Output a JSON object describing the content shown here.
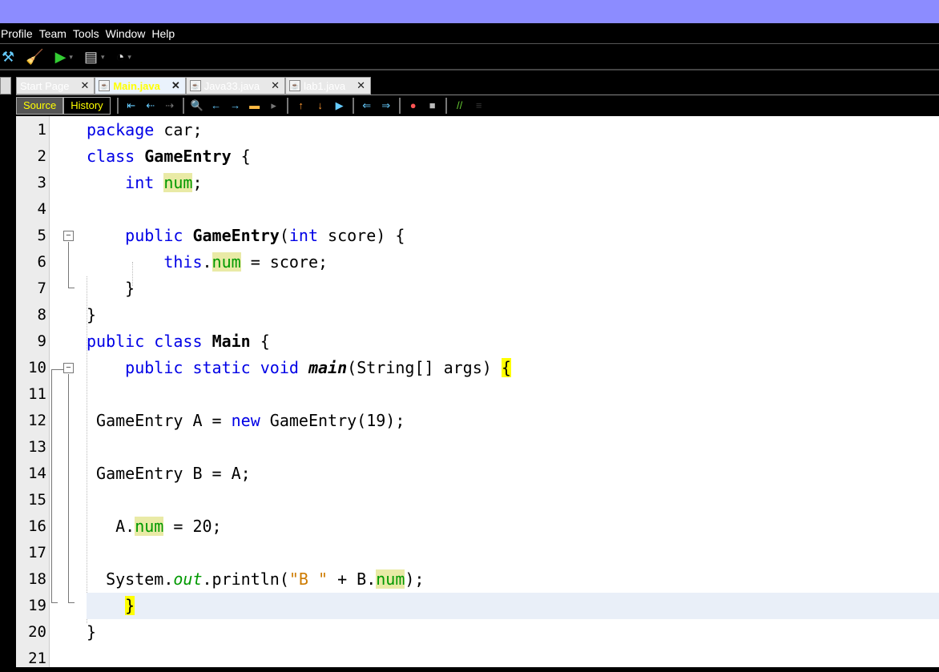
{
  "menu": [
    "Profile",
    "Team",
    "Tools",
    "Window",
    "Help"
  ],
  "tabs": [
    {
      "label": "Start Page",
      "active": false,
      "icon": ""
    },
    {
      "label": "Main.java",
      "active": true,
      "icon": "java-file-icon"
    },
    {
      "label": "Java33.java",
      "active": false,
      "icon": "java-file-error-icon"
    },
    {
      "label": "lab1.java",
      "active": false,
      "icon": "java-file-icon"
    }
  ],
  "editor_toolbar": {
    "source": "Source",
    "history": "History"
  },
  "code": [
    [
      [
        "package",
        "kw"
      ],
      [
        " car;",
        ""
      ]
    ],
    [
      [
        "class",
        "kw"
      ],
      [
        " ",
        ""
      ],
      [
        "GameEntry",
        "cls"
      ],
      [
        " {",
        ""
      ]
    ],
    [
      [
        "    ",
        ""
      ],
      [
        "int",
        "kw"
      ],
      [
        " ",
        ""
      ],
      [
        "num",
        "fld"
      ],
      [
        ";",
        ""
      ]
    ],
    [],
    [
      [
        "    ",
        ""
      ],
      [
        "public",
        "kw"
      ],
      [
        " ",
        ""
      ],
      [
        "GameEntry",
        "cls"
      ],
      [
        "(",
        ""
      ],
      [
        "int",
        "kw"
      ],
      [
        " score) {",
        ""
      ]
    ],
    [
      [
        "        ",
        ""
      ],
      [
        "this",
        "kw"
      ],
      [
        ".",
        ""
      ],
      [
        "num",
        "fld"
      ],
      [
        " = score;",
        ""
      ]
    ],
    [
      [
        "    }",
        ""
      ]
    ],
    [
      [
        "}",
        ""
      ]
    ],
    [
      [
        "public",
        "kw"
      ],
      [
        " ",
        ""
      ],
      [
        "class",
        "kw"
      ],
      [
        " ",
        ""
      ],
      [
        "Main",
        "cls"
      ],
      [
        " {",
        ""
      ]
    ],
    [
      [
        "    ",
        ""
      ],
      [
        "public",
        "kw"
      ],
      [
        " ",
        ""
      ],
      [
        "static",
        "kw"
      ],
      [
        " ",
        ""
      ],
      [
        "void",
        "kw"
      ],
      [
        " ",
        ""
      ],
      [
        "main",
        "meth"
      ],
      [
        "(String[] args) ",
        ""
      ],
      [
        "{",
        "br"
      ]
    ],
    [],
    [
      [
        " GameEntry A = ",
        ""
      ],
      [
        "new",
        "kw"
      ],
      [
        " GameEntry(19);",
        ""
      ]
    ],
    [],
    [
      [
        " GameEntry B = A;",
        ""
      ]
    ],
    [],
    [
      [
        "   A.",
        ""
      ],
      [
        "num",
        "fld"
      ],
      [
        " = 20;",
        ""
      ]
    ],
    [],
    [
      [
        "  System.",
        ""
      ],
      [
        "out",
        "st"
      ],
      [
        ".println(",
        ""
      ],
      [
        "\"B \"",
        "str"
      ],
      [
        " + B.",
        ""
      ],
      [
        "num",
        "fld"
      ],
      [
        ");",
        ""
      ]
    ],
    [
      [
        "    ",
        ""
      ],
      [
        "}",
        "br"
      ]
    ],
    [
      [
        "}",
        ""
      ]
    ],
    []
  ],
  "current_line": 19
}
